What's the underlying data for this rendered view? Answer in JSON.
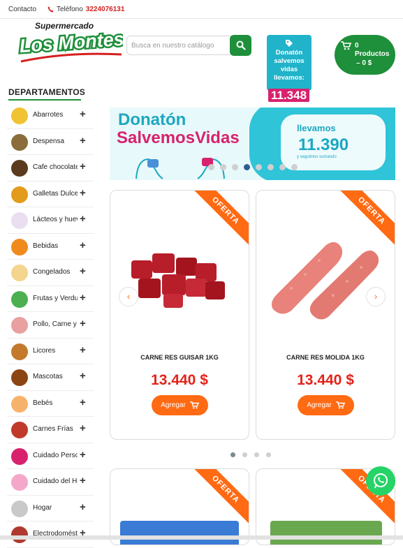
{
  "topbar": {
    "contact": "Contacto",
    "phone_label": "Teléfono",
    "phone_number": "3224076131"
  },
  "logo": {
    "line1": "Supermercado",
    "line2": "Los Montes"
  },
  "search": {
    "placeholder": "Busca en nuestro catálogo"
  },
  "donaton_widget": {
    "text": "Donatón salvemos vidas llevamos:",
    "count": "11.348"
  },
  "cart": {
    "count": "0",
    "label": "Productos",
    "total": "– 0 $"
  },
  "departments": {
    "title": "DEPARTAMENTOS",
    "items": [
      {
        "label": "Abarrotes",
        "icon": "oil-bottle-icon",
        "color": "#f1c232"
      },
      {
        "label": "Despensa",
        "icon": "jar-icon",
        "color": "#8a6d3b"
      },
      {
        "label": "Cafe chocolate",
        "icon": "coffee-icon",
        "color": "#5b3a1e"
      },
      {
        "label": "Galletas Dulces",
        "icon": "cookie-icon",
        "color": "#e39b1b"
      },
      {
        "label": "Lácteos y huevos",
        "icon": "dairy-icon",
        "color": "#e9dff0"
      },
      {
        "label": "Bebidas",
        "icon": "drinks-icon",
        "color": "#f08a1c"
      },
      {
        "label": "Congelados",
        "icon": "frozen-icon",
        "color": "#f4d58d"
      },
      {
        "label": "Frutas y Verduras",
        "icon": "fruit-icon",
        "color": "#4caf50"
      },
      {
        "label": "Pollo, Carne y Pescado",
        "icon": "meat-icon",
        "color": "#e8a0a0"
      },
      {
        "label": "Licores",
        "icon": "liquor-icon",
        "color": "#c47a2c"
      },
      {
        "label": "Mascotas",
        "icon": "pet-food-icon",
        "color": "#8b4513"
      },
      {
        "label": "Bebés",
        "icon": "baby-icon",
        "color": "#f6b26b"
      },
      {
        "label": "Carnes Frías",
        "icon": "sausage-icon",
        "color": "#c0392b"
      },
      {
        "label": "Cuidado Personal",
        "icon": "soap-icon",
        "color": "#d8226d"
      },
      {
        "label": "Cuidado del Hogar",
        "icon": "gloves-icon",
        "color": "#f4a7c8"
      },
      {
        "label": "Hogar",
        "icon": "home-icon",
        "color": "#c9c9c9"
      },
      {
        "label": "Electrodomésticos",
        "icon": "blender-icon",
        "color": "#b03a2e"
      }
    ]
  },
  "banner": {
    "title1": "Donatón",
    "title2": "SalvemosVidas",
    "llevamos": "llevamos",
    "number": "11.390",
    "sub": "y seguimos sumando"
  },
  "products": [
    {
      "name": "CARNE RES GUISAR 1KG",
      "price": "13.440 $",
      "badge": "OFERTA",
      "button": "Agregar"
    },
    {
      "name": "CARNE RES MOLIDA 1KG",
      "price": "13.440 $",
      "badge": "OFERTA",
      "button": "Agregar"
    }
  ],
  "products_row2": [
    {
      "badge": "OFERTA"
    },
    {
      "badge": "OFERTA"
    }
  ],
  "colors": {
    "brand_green": "#1e8f3a",
    "accent_orange": "#ff6a13",
    "price_red": "#e2231a",
    "donaton_teal": "#21b3c9",
    "donaton_pink": "#d8226d"
  }
}
